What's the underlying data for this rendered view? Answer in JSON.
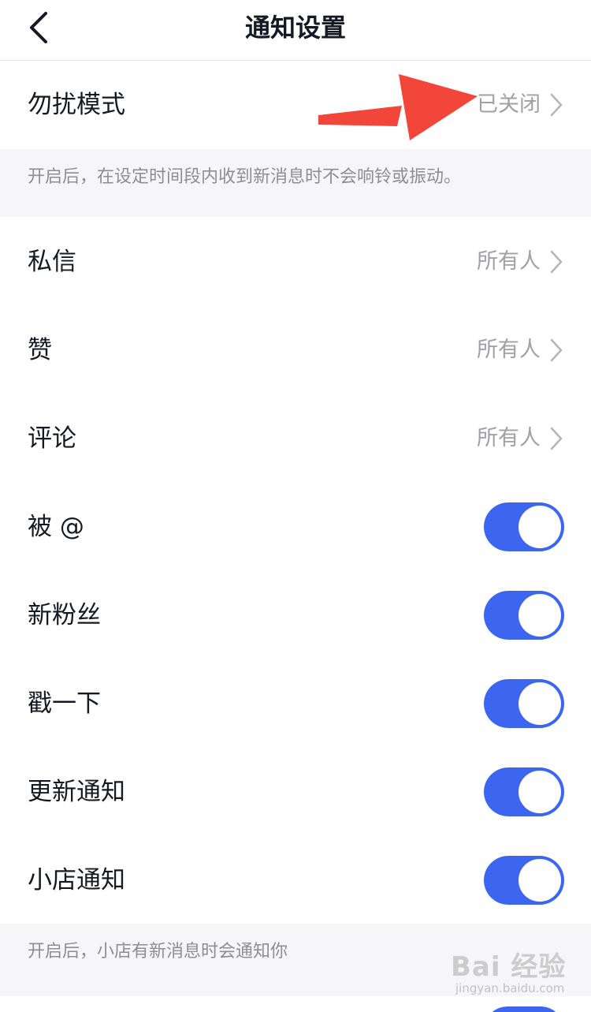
{
  "nav": {
    "title": "通知设置"
  },
  "dnd": {
    "label": "勿扰模式",
    "value": "已关闭",
    "hint": "开启后，在设定时间段内收到新消息时不会响铃或振动。"
  },
  "rows": [
    {
      "label": "私信",
      "value": "所有人"
    },
    {
      "label": "赞",
      "value": "所有人"
    },
    {
      "label": "评论",
      "value": "所有人"
    }
  ],
  "toggles": [
    {
      "label": "被 @",
      "on": true
    },
    {
      "label": "新粉丝",
      "on": true
    },
    {
      "label": "戳一下",
      "on": true
    },
    {
      "label": "更新通知",
      "on": true
    },
    {
      "label": "小店通知",
      "on": true
    }
  ],
  "shop_hint": "开启后，小店有新消息时会通知你",
  "watermark": {
    "logo": "Bai 经验",
    "sub": "jingyan.baidu.com"
  },
  "colors": {
    "accent": "#3d66f0",
    "arrow": "#f2463a",
    "hint_bg": "#f6f6f8"
  }
}
